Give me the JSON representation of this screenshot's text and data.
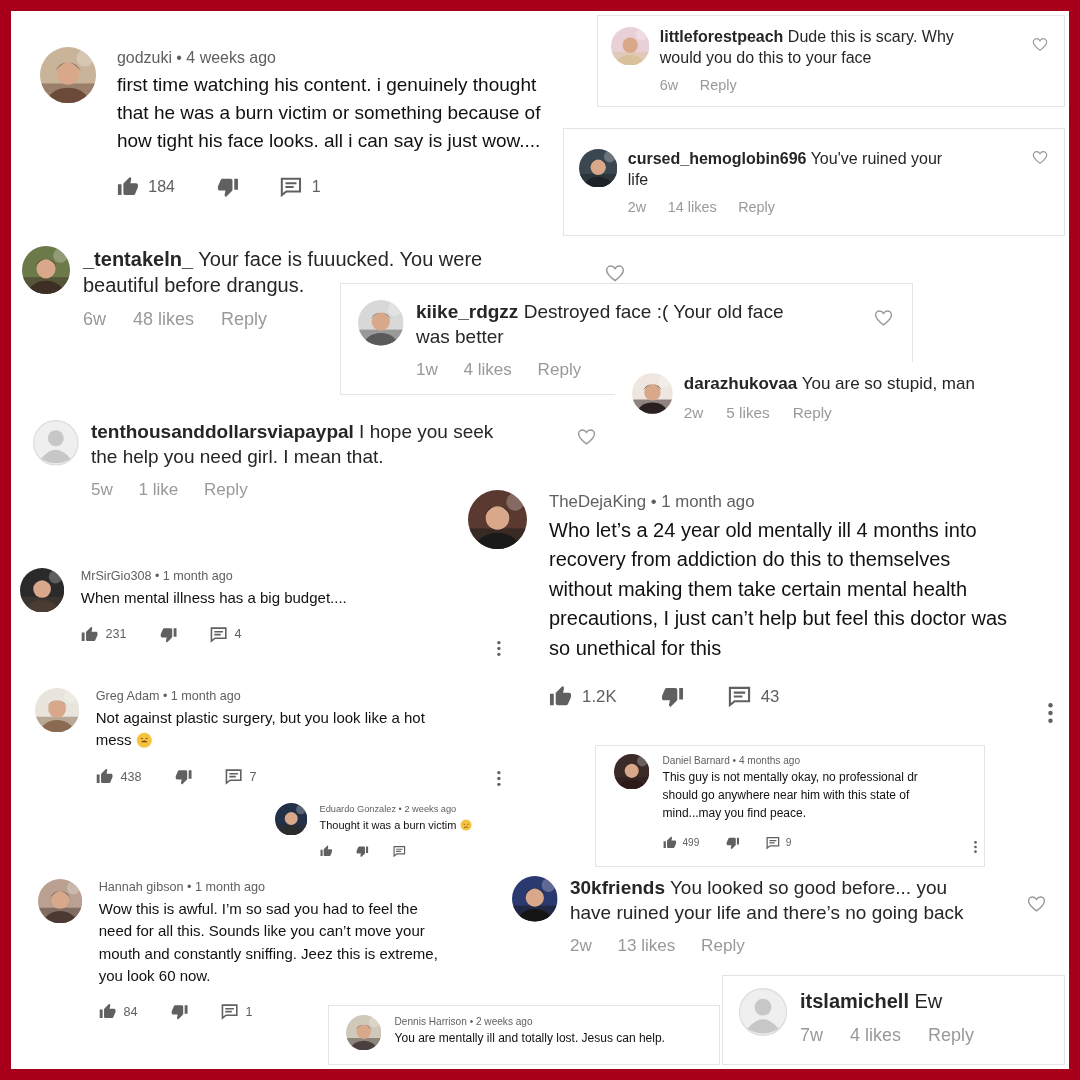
{
  "comments": [
    {
      "kind": "youtube",
      "default_avatar": false,
      "header": "godzuki • 4 weeks ago",
      "text": "first time watching his content. i genuinely thought that he was a burn victim or something because of how tight his face looks. all i can say is just wow....",
      "actions": true,
      "likes": "184",
      "replies": "1",
      "more": false
    },
    {
      "kind": "instagram",
      "default_avatar": false,
      "text": "**littleforestpeach** Dude this is scary. Why would you do this to your face",
      "age": "6w",
      "reply": "Reply",
      "heart": true
    },
    {
      "kind": "instagram",
      "default_avatar": false,
      "text": "**cursed_hemoglobin696** You've ruined your life",
      "age": "2w",
      "likes": "14 likes",
      "reply": "Reply",
      "heart": true
    },
    {
      "kind": "instagram",
      "default_avatar": false,
      "text": "**_tentakeln_** Your face is fuuucked. You were beautiful before drangus.",
      "age": "6w",
      "likes": "48 likes",
      "reply": "Reply",
      "heart": true
    },
    {
      "kind": "instagram",
      "default_avatar": false,
      "text": "**kiike_rdgzz** Destroyed face :( Your old face was better",
      "age": "1w",
      "likes": "4 likes",
      "reply": "Reply",
      "heart": true
    },
    {
      "kind": "instagram",
      "default_avatar": false,
      "text": "**darazhukovaa** You are so stupid, man",
      "age": "2w",
      "likes": "5 likes",
      "reply": "Reply",
      "heart": false
    },
    {
      "kind": "instagram",
      "default_avatar": true,
      "text": "**tenthousanddollarsviapaypal** I hope you seek the help you need girl. I mean that.",
      "age": "5w",
      "likes": "1 like",
      "reply": "Reply",
      "heart": true
    },
    {
      "kind": "youtube",
      "default_avatar": false,
      "header": "MrSirGio308 • 1 month ago",
      "text": "When mental illness has a big budget....",
      "actions": true,
      "likes": "231",
      "replies": "4",
      "more": true
    },
    {
      "kind": "youtube",
      "default_avatar": false,
      "header": "Greg Adam • 1 month ago",
      "text": "Not against plastic surgery, but you look like a hot mess",
      "emoji": {
        "kind": "weary"
      },
      "actions": true,
      "likes": "438",
      "replies": "7",
      "more": true
    },
    {
      "kind": "youtube",
      "default_avatar": false,
      "header": "Eduardo Gonzalez • 2 weeks ago",
      "text": "Thought it was a burn victim",
      "emoji": {
        "kind": "sad"
      },
      "actions": true,
      "more": false
    },
    {
      "kind": "youtube",
      "default_avatar": false,
      "header": "Hannah gibson • 1 month ago",
      "text": "Wow this is awful. I’m so sad you had to feel the need for all this. Sounds like you can’t move your mouth and constantly sniffing. Jeez this is extreme, you look 60 now.",
      "actions": true,
      "likes": "84",
      "replies": "1",
      "more": false
    },
    {
      "kind": "youtube",
      "default_avatar": false,
      "header": "Dennis Harrison • 2 weeks ago",
      "text": "You are mentally ill and totally lost.  Jesus can help.",
      "actions": false,
      "more": false
    },
    {
      "kind": "youtube",
      "default_avatar": false,
      "header": "TheDejaKing • 1 month ago",
      "text": "Who let’s a 24 year old mentally ill 4 months into recovery from addiction do this to themselves without making them take certain mental health precautions, I just can’t help but feel this doctor was so unethical for this",
      "actions": true,
      "likes": "1.2K",
      "replies": "43",
      "more": true
    },
    {
      "kind": "youtube",
      "default_avatar": false,
      "header": "Daniel Barnard • 4 months ago",
      "text": "This guy is not mentally okay, no professional dr should go anywhere near him with this state of mind...may you find peace.",
      "actions": true,
      "likes": "499",
      "replies": "9",
      "more": true
    },
    {
      "kind": "instagram",
      "default_avatar": false,
      "text": "**30kfriends** You looked so good before... you have ruined your life and there’s no going back",
      "age": "2w",
      "likes": "13 likes",
      "reply": "Reply",
      "heart": true
    },
    {
      "kind": "instagram",
      "default_avatar": true,
      "text": "**itslamichell** Ew",
      "age": "7w",
      "likes": "4 likes",
      "reply": "Reply",
      "heart": false
    }
  ]
}
